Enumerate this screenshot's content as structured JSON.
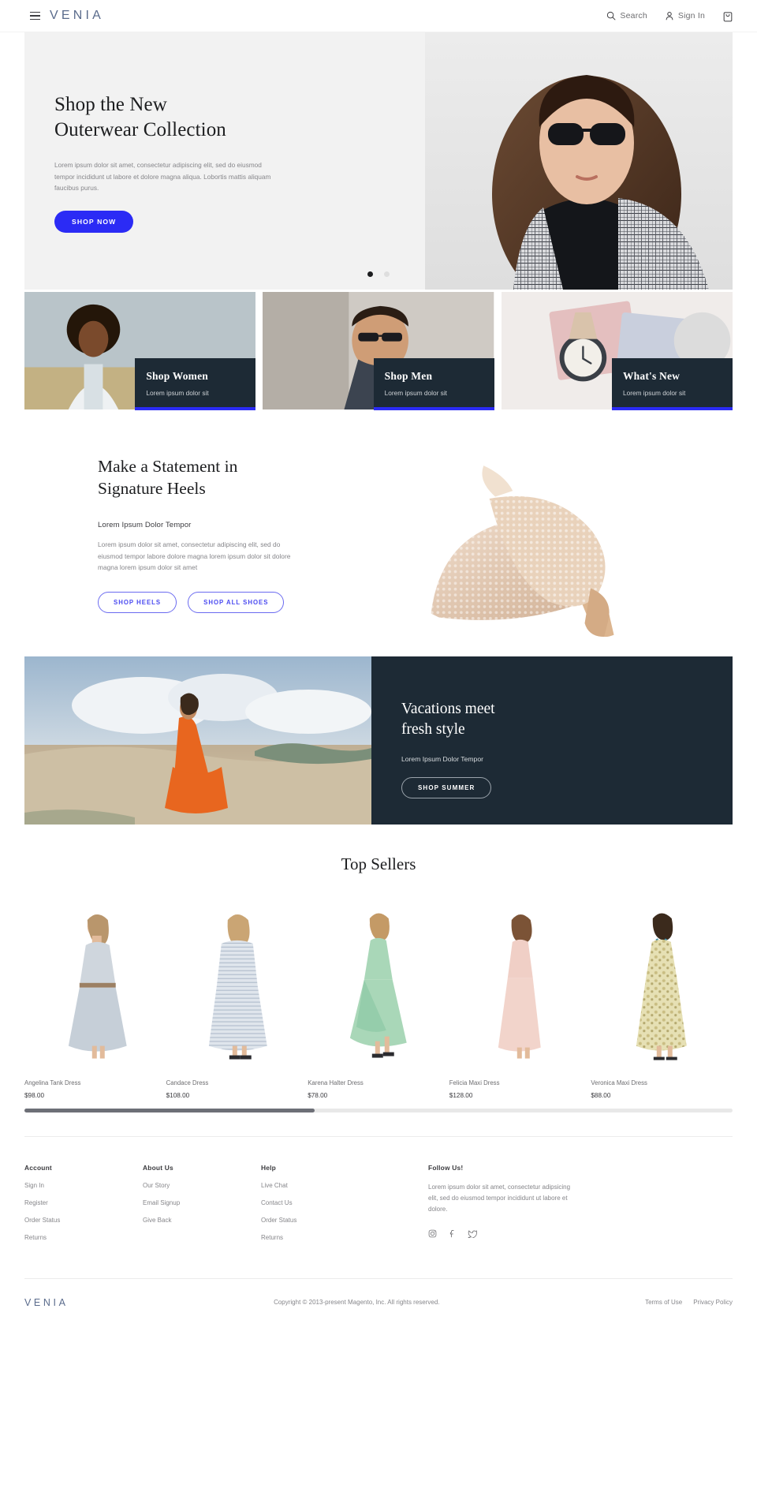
{
  "header": {
    "logo": "VENIA",
    "menu_icon": "hamburger-icon",
    "search_label": "Search",
    "signin_label": "Sign In",
    "cart_icon": "shopping-bag-icon"
  },
  "hero": {
    "title_line1": "Shop the New",
    "title_line2": "Outerwear Collection",
    "description": "Lorem ipsum dolor sit amet, consectetur adipiscing elit, sed do eiusmod tempor incididunt ut labore et dolore magna aliqua. Lobortis mattis aliquam faucibus purus.",
    "cta_label": "SHOP NOW",
    "accent_color": "#2b2bf5",
    "background_color": "#f2f2f2",
    "dots": 2,
    "active_dot": 1
  },
  "categories": [
    {
      "title": "Shop Women",
      "subtitle": "Lorem ipsum dolor sit"
    },
    {
      "title": "Shop Men",
      "subtitle": "Lorem ipsum dolor sit"
    },
    {
      "title": "What's New",
      "subtitle": "Lorem ipsum dolor sit"
    }
  ],
  "heels": {
    "title_line1": "Make a Statement in",
    "title_line2": "Signature Heels",
    "kicker": "Lorem Ipsum Dolor Tempor",
    "body": "Lorem ipsum dolor sit amet, consectetur adipiscing elit, sed do eiusmod tempor labore dolore magna lorem ipsum dolor sit dolore magna lorem ipsum dolor sit amet",
    "button_primary": "SHOP HEELS",
    "button_secondary": "SHOP ALL SHOES"
  },
  "vacation": {
    "title_line1": "Vacations meet",
    "title_line2": "fresh style",
    "subtitle": "Lorem Ipsum Dolor Tempor",
    "cta_label": "SHOP SUMMER",
    "panel_color": "#1d2a35"
  },
  "top_sellers": {
    "heading": "Top Sellers",
    "products": [
      {
        "name": "Angelina Tank Dress",
        "price": "$98.00"
      },
      {
        "name": "Candace Dress",
        "price": "$108.00"
      },
      {
        "name": "Karena Halter Dress",
        "price": "$78.00"
      },
      {
        "name": "Felicia Maxi Dress",
        "price": "$128.00"
      },
      {
        "name": "Veronica Maxi Dress",
        "price": "$88.00"
      }
    ]
  },
  "footer": {
    "columns": [
      {
        "heading": "Account",
        "links": [
          "Sign In",
          "Register",
          "Order Status",
          "Returns"
        ]
      },
      {
        "heading": "About Us",
        "links": [
          "Our Story",
          "Email Signup",
          "Give Back"
        ]
      },
      {
        "heading": "Help",
        "links": [
          "Live Chat",
          "Contact Us",
          "Order Status",
          "Returns"
        ]
      }
    ],
    "follow": {
      "heading": "Follow Us!",
      "text": "Lorem ipsum dolor sit amet, consectetur adipsicing elit, sed do eiusmod tempor incididunt ut labore et dolore.",
      "socials": [
        "instagram-icon",
        "facebook-icon",
        "twitter-icon"
      ]
    }
  },
  "bottom": {
    "logo": "VENIA",
    "copyright": "Copyright © 2013-present Magento, Inc. All rights reserved.",
    "links": [
      "Terms of Use",
      "Privacy Policy"
    ]
  }
}
